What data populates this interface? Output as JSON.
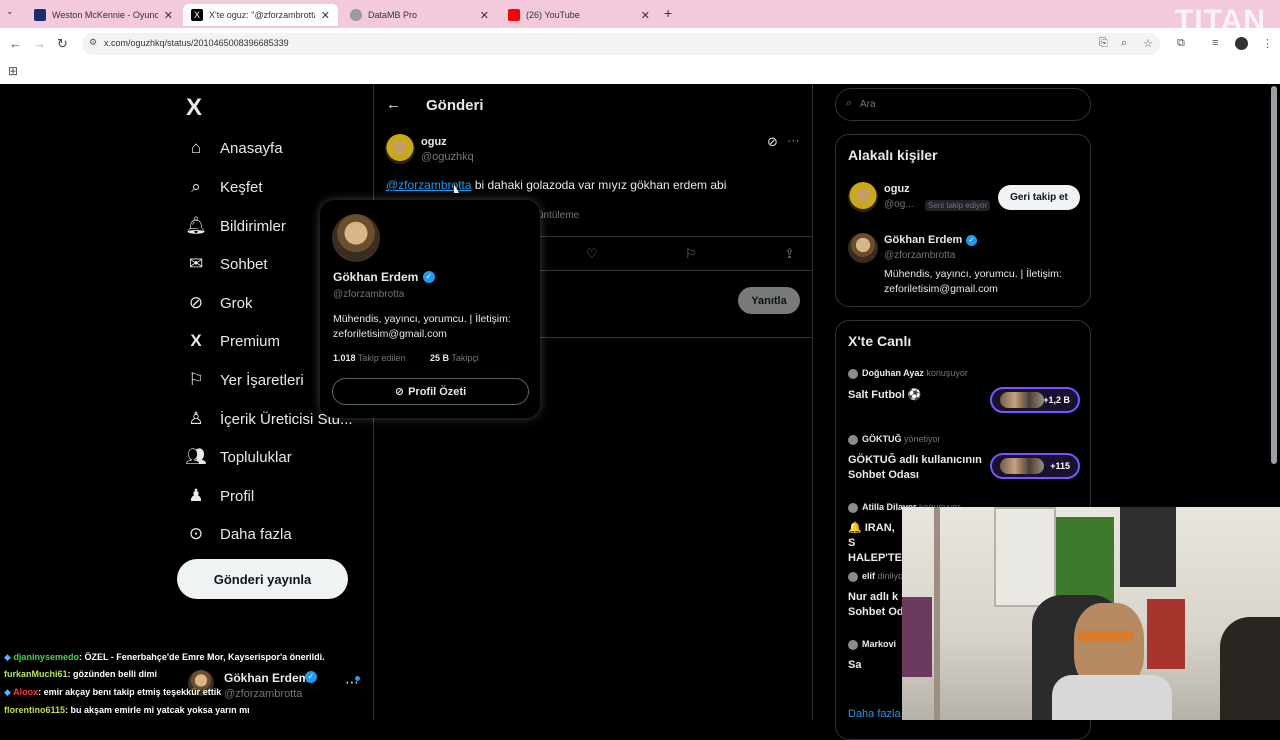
{
  "browser": {
    "tabs": [
      {
        "title": "Weston McKennie - Oyuncu pro",
        "favicon_color": "#1c2d6e"
      },
      {
        "title": "X'te oguz: \"@zforzambrotta bi d",
        "favicon_color": "#000000",
        "active": true
      },
      {
        "title": "DataMB Pro",
        "favicon_color": "#9a9a9a"
      },
      {
        "title": "(26) YouTube",
        "favicon_color": "#ff0000"
      }
    ],
    "url": "x.com/oguzhkq/status/2010465008396685339",
    "watermark": "TITAN"
  },
  "sidebar": {
    "logo": "X",
    "items": [
      {
        "label": "Anasayfa",
        "icon": "home-icon"
      },
      {
        "label": "Keşfet",
        "icon": "search-icon"
      },
      {
        "label": "Bildirimler",
        "icon": "bell-icon"
      },
      {
        "label": "Sohbet",
        "icon": "mail-icon"
      },
      {
        "label": "Grok",
        "icon": "grok-icon"
      },
      {
        "label": "Premium",
        "icon": "x-icon"
      },
      {
        "label": "Yer İşaretleri",
        "icon": "bookmark-icon"
      },
      {
        "label": "İçerik Üreticisi Stu...",
        "icon": "creator-icon"
      },
      {
        "label": "Topluluklar",
        "icon": "communities-icon"
      },
      {
        "label": "Profil",
        "icon": "person-icon"
      },
      {
        "label": "Daha fazla",
        "icon": "more-icon"
      }
    ],
    "post_button": "Gönderi yayınla",
    "account": {
      "name": "Gökhan Erdem",
      "handle": "@zforzambrotta"
    }
  },
  "main": {
    "header": "Gönderi",
    "post": {
      "author": "oguz",
      "handle": "@oguzhkq",
      "mention": "@zforzambrotta",
      "text": " bi dahaki golazoda var mıyız gökhan erdem abi",
      "views_fragment": "üntüleme",
      "reply_button": "Yanıtla"
    }
  },
  "hovercard": {
    "name": "Gökhan Erdem",
    "handle": "@zforzambrotta",
    "bio": "Mühendis, yayıncı, yorumcu. | İletişim: zeforiletisim@gmail.com",
    "following_count": "1.018",
    "following_label": "Takip edilen",
    "followers_count": "25 B",
    "followers_label": "Takipçi",
    "button": "Profil Özeti"
  },
  "right": {
    "search_placeholder": "Ara",
    "related": {
      "title": "Alakalı kişiler",
      "people": [
        {
          "name": "oguz",
          "handle": "@og...",
          "badge": "Seni takip ediyor",
          "button": "Geri takip et"
        },
        {
          "name": "Gökhan Erdem",
          "handle": "@zforzambrotta",
          "bio": "Mühendis, yayıncı, yorumcu. | İletişim: zeforiletisim@gmail.com"
        }
      ]
    },
    "live": {
      "title": "X'te Canlı",
      "spaces": [
        {
          "host": "Doğuhan Ayaz",
          "status": "konuşuyor",
          "title": "Salt Futbol ⚽",
          "count": "+1,2 B"
        },
        {
          "host": "GÖKTUĞ",
          "status": "yönetiyor",
          "title": "GÖKTUĞ adlı kullanıcının Sohbet Odası",
          "count": "+115"
        },
        {
          "host": "Atilla Dilaver",
          "status": "konuşuyor",
          "title": "🔔 IRAN, S HALEP'TE"
        },
        {
          "host": "elif",
          "status": "dinliyo",
          "title": "Nur adlı k Sohbet Od"
        },
        {
          "host": "Markovi",
          "status": "",
          "title": "Sa"
        }
      ],
      "more": "Daha fazla"
    }
  },
  "chat": [
    {
      "user": "djaninysemedo",
      "msg": ": ÖZEL - Fenerbahçe'de Emre Mor, Kayserispor'a önerildi.",
      "color": "#3ad64b"
    },
    {
      "user": "furkanMuchi61",
      "msg": ": gözünden belli dimi",
      "color": "#b3e65a"
    },
    {
      "user": "Aloox",
      "msg": ": emir akçay benı takip etmiş teşekkür ettik",
      "color": "#ff3b3b"
    },
    {
      "user": "florentino6115",
      "msg": ": bu akşam emirle mi yatcak yoksa yarın mı",
      "color": "#c7d94a"
    }
  ]
}
